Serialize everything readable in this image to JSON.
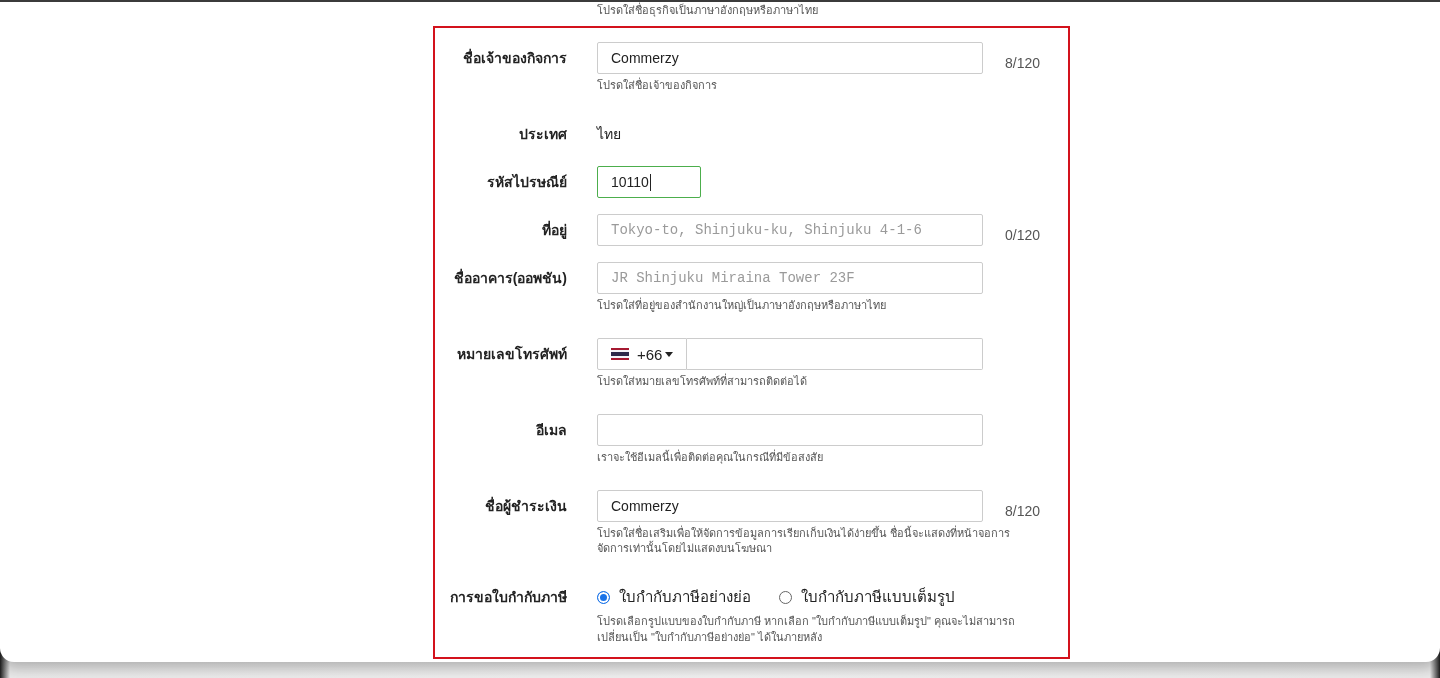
{
  "previous_field": {
    "hint": "โปรดใส่ชื่อธุรกิจเป็นภาษาอังกฤษหรือภาษาไทย"
  },
  "fields": [
    {
      "kind": "text",
      "label": "ชื่อเจ้าของกิจการ",
      "value": "Commerzy",
      "focused": false,
      "counter": "8/120",
      "hint": "โปรดใส่ชื่อเจ้าของกิจการ"
    },
    {
      "kind": "static",
      "label": "ประเทศ",
      "value": "ไทย"
    },
    {
      "kind": "short",
      "label": "รหัสไปรษณีย์",
      "value": "10110",
      "focused": true
    },
    {
      "kind": "text",
      "label": "ที่อยู่",
      "placeholder": "Tokyo-to, Shinjuku-ku, Shinjuku 4-1-6",
      "focused": false,
      "counter": "0/120"
    },
    {
      "kind": "text",
      "label": "ชื่ออาคาร(ออพชัน)",
      "placeholder": "JR Shinjuku Miraina Tower 23F",
      "focused": false,
      "hint": "โปรดใส่ที่อยู่ของสำนักงานใหญ่เป็นภาษาอังกฤษหรือภาษาไทย"
    },
    {
      "kind": "phone",
      "label": "หมายเลขโทรศัพท์",
      "dial_code": "+66",
      "focused": false,
      "hint": "โปรดใส่หมายเลขโทรศัพท์ที่สามารถติดต่อได้"
    },
    {
      "kind": "text",
      "label": "อีเมล",
      "focused": false,
      "hint": "เราจะใช้อีเมลนี้เพื่อติดต่อคุณในกรณีที่มีข้อสงสัย"
    },
    {
      "kind": "text",
      "label": "ชื่อผู้ชำระเงิน",
      "value": "Commerzy",
      "focused": false,
      "counter": "8/120",
      "hint": "โปรดใส่ชื่อเสริมเพื่อให้จัดการข้อมูลการเรียกเก็บเงินได้ง่ายขึ้น ชื่อนี้จะแสดงที่หน้าจอการจัดการเท่านั้นโดยไม่แสดงบนโฆษณา"
    },
    {
      "kind": "radio",
      "label": "การขอใบกำกับภาษี",
      "options": [
        {
          "label": "ใบกำกับภาษีอย่างย่อ",
          "selected": true
        },
        {
          "label": "ใบกำกับภาษีแบบเต็มรูป",
          "selected": false
        }
      ],
      "hint": "โปรดเลือกรูปแบบของใบกำกับภาษี หากเลือก \"ใบกำกับภาษีแบบเต็มรูป\" คุณจะไม่สามารถเปลี่ยนเป็น \"ใบกำกับภาษีอย่างย่อ\" ได้ในภายหลัง"
    }
  ]
}
